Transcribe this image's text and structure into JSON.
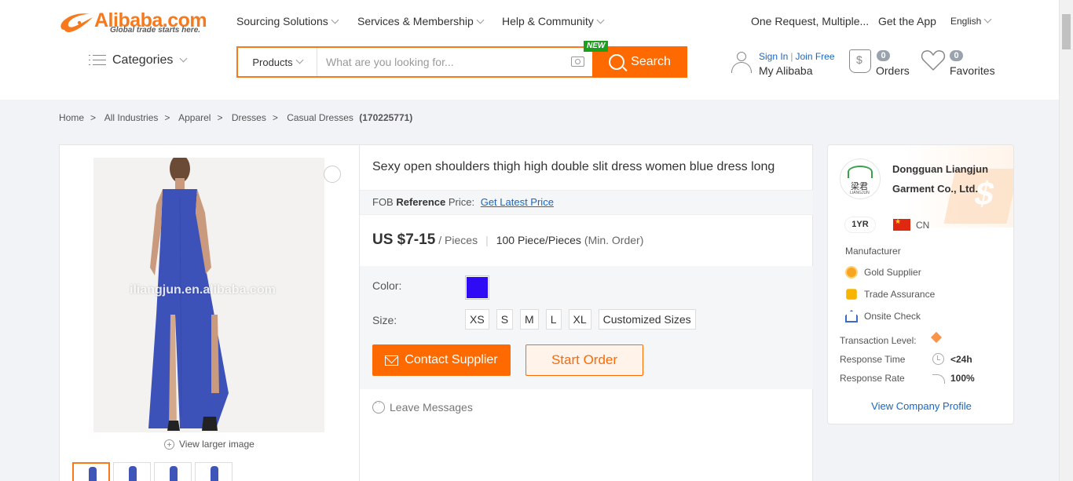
{
  "brand": {
    "name": "Alibaba.com",
    "tagline": "Global trade starts here.",
    "colors": {
      "accent": "#ff6a00",
      "link": "#1a66c2",
      "badge_new": "#1c9f1c"
    }
  },
  "top_nav": {
    "sourcing": "Sourcing Solutions",
    "services": "Services & Membership",
    "help": "Help & Community",
    "one_request": "One Request, Multiple...",
    "get_app": "Get the App",
    "language": "English"
  },
  "categories_label": "Categories",
  "search": {
    "category": "Products",
    "placeholder": "What are you looking for...",
    "button": "Search",
    "new_badge": "NEW"
  },
  "account": {
    "sign_in": "Sign In",
    "join_free": "Join Free",
    "my_alibaba": "My Alibaba",
    "orders_count": "0",
    "orders_label": "Orders",
    "favorites_count": "0",
    "favorites_label": "Favorites"
  },
  "breadcrumb": {
    "items": [
      "Home",
      "All Industries",
      "Apparel",
      "Dresses",
      "Casual Dresses"
    ],
    "separator": ">",
    "code": "(170225771)"
  },
  "gallery": {
    "watermark": "iliangjun.en.alibaba.com",
    "view_larger": "View larger image"
  },
  "product": {
    "title": "Sexy open shoulders thigh high double slit dress women blue dress long",
    "fob_prefix": "FOB",
    "fob_bold": "Reference",
    "fob_suffix": "Price:",
    "get_price": "Get Latest Price",
    "price": "US $7-15",
    "price_unit": "/ Pieces",
    "price_sep": "|",
    "moq": "100 Piece/Pieces",
    "moq_note": "(Min. Order)",
    "color_label": "Color:",
    "color_swatch": "#2f0af5",
    "size_label": "Size:",
    "sizes": [
      "XS",
      "S",
      "M",
      "L",
      "XL",
      "Customized Sizes"
    ],
    "contact_button": "Contact Supplier",
    "order_button": "Start Order",
    "leave_messages": "Leave Messages"
  },
  "supplier": {
    "name": "Dongguan Liangjun Garment Co., Ltd.",
    "logo_text": "梁君",
    "logo_subtext": "LIANGJUN",
    "years": "1YR",
    "country": "CN",
    "type": "Manufacturer",
    "badges": [
      "Gold Supplier",
      "Trade Assurance",
      "Onsite Check"
    ],
    "transaction_level_label": "Transaction Level:",
    "response_time_label": "Response Time",
    "response_time_value": "<24h",
    "response_rate_label": "Response Rate",
    "response_rate_value": "100%",
    "profile_link": "View Company Profile"
  }
}
